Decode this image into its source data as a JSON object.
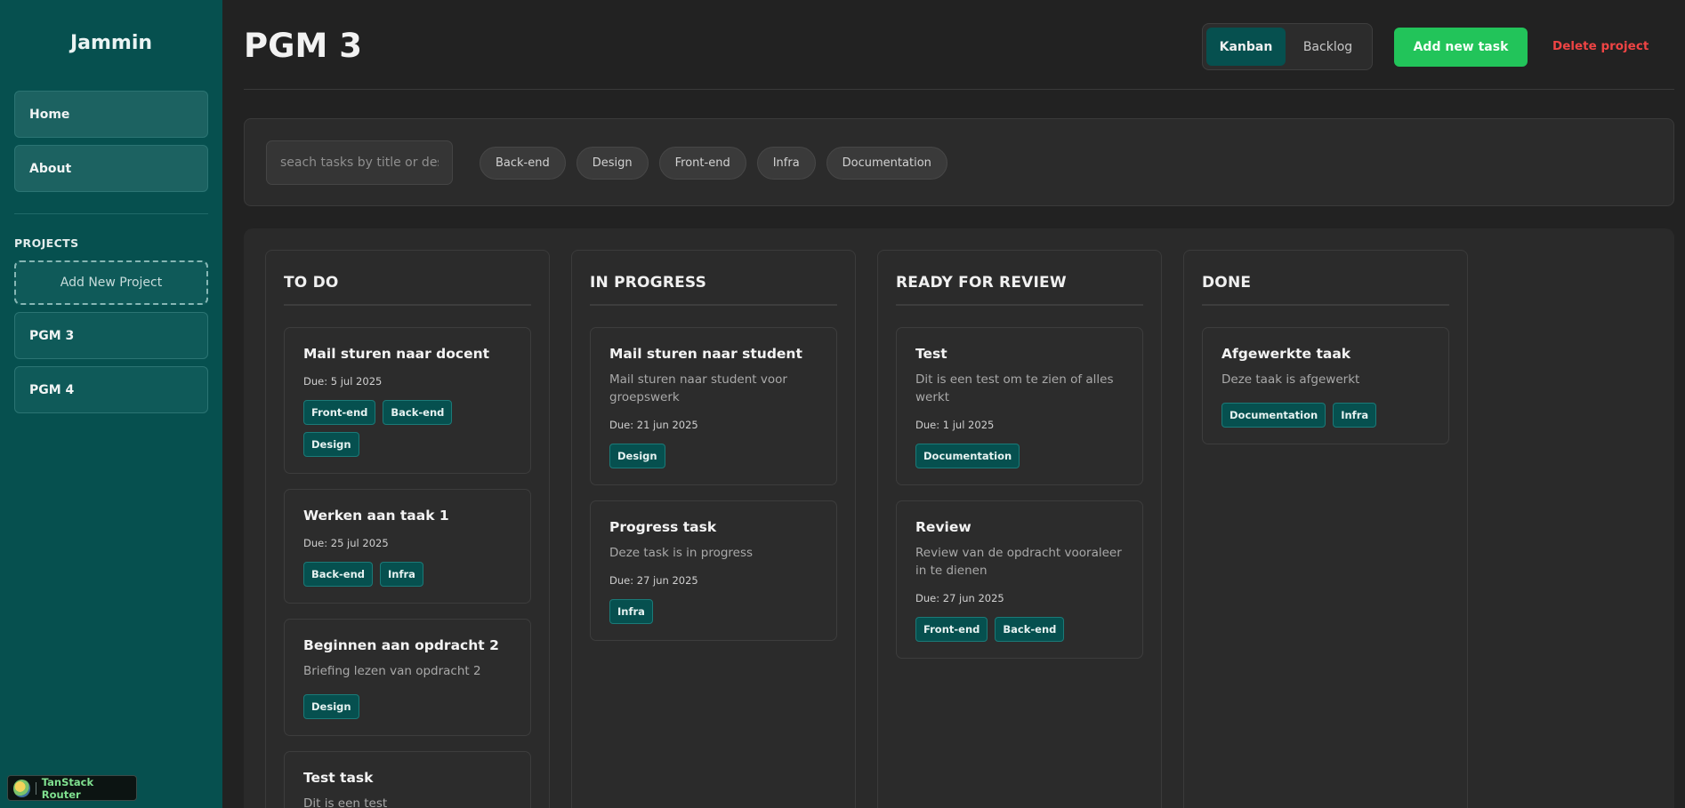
{
  "sidebar": {
    "brand": "Jammin",
    "nav": [
      {
        "label": "Home"
      },
      {
        "label": "About"
      }
    ],
    "projects_heading": "PROJECTS",
    "add_project_label": "Add New Project",
    "projects": [
      {
        "label": "PGM 3"
      },
      {
        "label": "PGM 4"
      }
    ],
    "devtools_label": "TanStack Router"
  },
  "header": {
    "title": "PGM 3",
    "view_toggle": {
      "active": "Kanban",
      "inactive": "Backlog"
    },
    "add_task_label": "Add new task",
    "delete_project_label": "Delete project"
  },
  "filters": {
    "search_placeholder": "seach tasks by title or description",
    "search_value": "",
    "tags": [
      "Back-end",
      "Design",
      "Front-end",
      "Infra",
      "Documentation"
    ]
  },
  "board": {
    "columns": [
      {
        "title": "TO DO",
        "cards": [
          {
            "title": "Mail sturen naar docent",
            "description": "",
            "due": "Due: 5 jul 2025",
            "tags": [
              "Front-end",
              "Back-end",
              "Design"
            ]
          },
          {
            "title": "Werken aan taak 1",
            "description": "",
            "due": "Due: 25 jul 2025",
            "tags": [
              "Back-end",
              "Infra"
            ]
          },
          {
            "title": "Beginnen aan opdracht 2",
            "description": "Briefing lezen van opdracht 2",
            "due": "",
            "tags": [
              "Design"
            ]
          },
          {
            "title": "Test task",
            "description": "Dit is een test",
            "due": "",
            "tags": []
          }
        ]
      },
      {
        "title": "IN PROGRESS",
        "cards": [
          {
            "title": "Mail sturen naar student",
            "description": "Mail sturen naar student voor groepswerk",
            "due": "Due: 21 jun 2025",
            "tags": [
              "Design"
            ]
          },
          {
            "title": "Progress task",
            "description": "Deze task is in progress",
            "due": "Due: 27 jun 2025",
            "tags": [
              "Infra"
            ]
          }
        ]
      },
      {
        "title": "READY FOR REVIEW",
        "cards": [
          {
            "title": "Test",
            "description": "Dit is een test om te zien of alles werkt",
            "due": "Due: 1 jul 2025",
            "tags": [
              "Documentation"
            ]
          },
          {
            "title": "Review",
            "description": "Review van de opdracht vooraleer in te dienen",
            "due": "Due: 27 jun 2025",
            "tags": [
              "Front-end",
              "Back-end"
            ]
          }
        ]
      },
      {
        "title": "DONE",
        "cards": [
          {
            "title": "Afgewerkte taak",
            "description": "Deze taak is afgewerkt",
            "due": "",
            "tags": [
              "Documentation",
              "Infra"
            ]
          }
        ]
      }
    ]
  },
  "colors": {
    "sidebar_bg": "#06504f",
    "accent_green": "#22c45a",
    "danger_red": "#ef4444",
    "tag_bg": "#06504f",
    "page_bg": "#222222"
  }
}
